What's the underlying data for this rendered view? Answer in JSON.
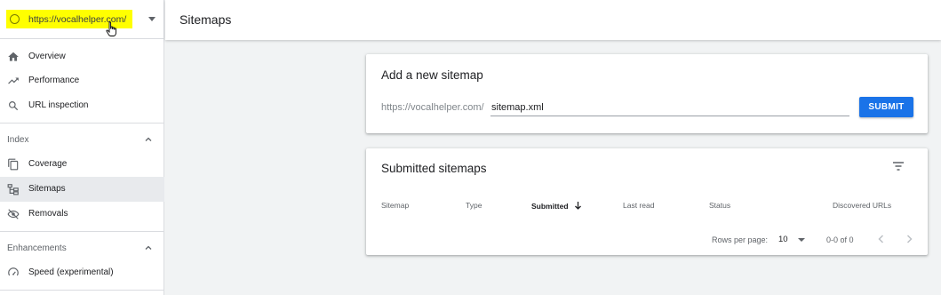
{
  "property": {
    "url": "https://vocalhelper.com/",
    "highlight_color": "#ffff00"
  },
  "sidebar": {
    "items": [
      {
        "label": "Overview",
        "icon": "home-icon"
      },
      {
        "label": "Performance",
        "icon": "trending-up-icon"
      },
      {
        "label": "URL inspection",
        "icon": "search-icon"
      }
    ],
    "index_section": {
      "label": "Index",
      "items": [
        {
          "label": "Coverage",
          "icon": "copy-icon"
        },
        {
          "label": "Sitemaps",
          "icon": "sitemap-icon",
          "active": true
        },
        {
          "label": "Removals",
          "icon": "eye-off-icon"
        }
      ]
    },
    "enhancements_section": {
      "label": "Enhancements",
      "items": [
        {
          "label": "Speed (experimental)",
          "icon": "speedometer-icon"
        }
      ]
    }
  },
  "header": {
    "title": "Sitemaps"
  },
  "add_sitemap": {
    "title": "Add a new sitemap",
    "prefix": "https://vocalhelper.com/",
    "input_value": "sitemap.xml",
    "submit_label": "SUBMIT"
  },
  "submitted": {
    "title": "Submitted sitemaps",
    "columns": [
      "Sitemap",
      "Type",
      "Submitted",
      "Last read",
      "Status",
      "Discovered URLs"
    ],
    "sorted_column": "Submitted",
    "rows_per_page_label": "Rows per page:",
    "rows_per_page_value": "10",
    "range": "0-0 of 0"
  },
  "colors": {
    "accent": "#1a73e8",
    "active_bg": "#e8eaed"
  }
}
